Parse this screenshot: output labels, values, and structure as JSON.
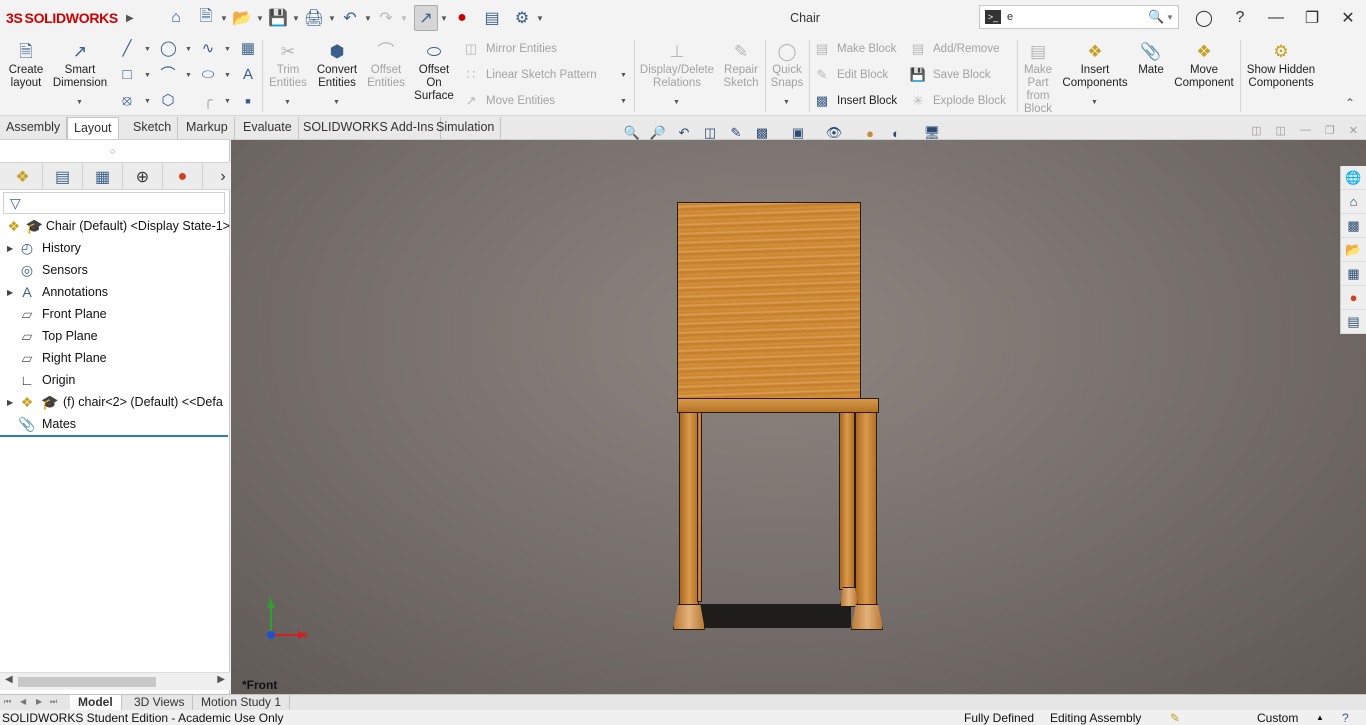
{
  "app": {
    "brand": "SOLIDWORKS",
    "brand_prefix": "3S",
    "document_title": "Chair"
  },
  "search": {
    "value": "e",
    "prompt_glyph": ">_"
  },
  "ribbon": {
    "create_layout": "Create layout",
    "smart_dimension": "Smart Dimension",
    "trim_entities": "Trim Entities",
    "convert_entities": "Convert Entities",
    "offset_entities": "Offset Entities",
    "offset_on_surface": "Offset On Surface",
    "mirror_entities": "Mirror Entities",
    "linear_sketch_pattern": "Linear Sketch Pattern",
    "move_entities": "Move Entities",
    "display_delete_relations": "Display/Delete Relations",
    "repair_sketch": "Repair Sketch",
    "quick_snaps": "Quick Snaps",
    "make_block": "Make Block",
    "edit_block": "Edit Block",
    "insert_block": "Insert Block",
    "add_remove": "Add/Remove",
    "save_block": "Save Block",
    "explode_block": "Explode Block",
    "make_part_from_block": "Make Part from Block",
    "insert_components": "Insert Components",
    "mate": "Mate",
    "move_component": "Move Component",
    "show_hidden_components": "Show Hidden Components"
  },
  "tabs": [
    "Assembly",
    "Layout",
    "Sketch",
    "Markup",
    "Evaluate",
    "SOLIDWORKS Add-Ins",
    "Simulation"
  ],
  "active_tab": "Layout",
  "feature_tree": [
    {
      "label": "Chair (Default) <Display State-1>",
      "icon": "assembly-icon"
    },
    {
      "label": "History",
      "icon": "history-icon"
    },
    {
      "label": "Sensors",
      "icon": "sensor-icon"
    },
    {
      "label": "Annotations",
      "icon": "annotations-icon"
    },
    {
      "label": "Front Plane",
      "icon": "plane-icon"
    },
    {
      "label": "Top Plane",
      "icon": "plane-icon"
    },
    {
      "label": "Right Plane",
      "icon": "plane-icon"
    },
    {
      "label": "Origin",
      "icon": "origin-icon"
    },
    {
      "label": "(f) chair<2> (Default) <<Defa",
      "icon": "component-icon"
    },
    {
      "label": "Mates",
      "icon": "mates-icon"
    }
  ],
  "viewport": {
    "view_name": "*Front",
    "triad_x": "X",
    "triad_y": "Y"
  },
  "bottom_tabs": [
    "Model",
    "3D Views",
    "Motion Study 1"
  ],
  "status": {
    "left": "SOLIDWORKS Student Edition - Academic Use Only",
    "definition": "Fully Defined",
    "mode": "Editing Assembly",
    "units": "Custom"
  },
  "colors": {
    "brand": "#d00000",
    "viewport_bg": "#7b7470",
    "wood": "#d08c37",
    "active_divider": "#2e7bbf"
  }
}
